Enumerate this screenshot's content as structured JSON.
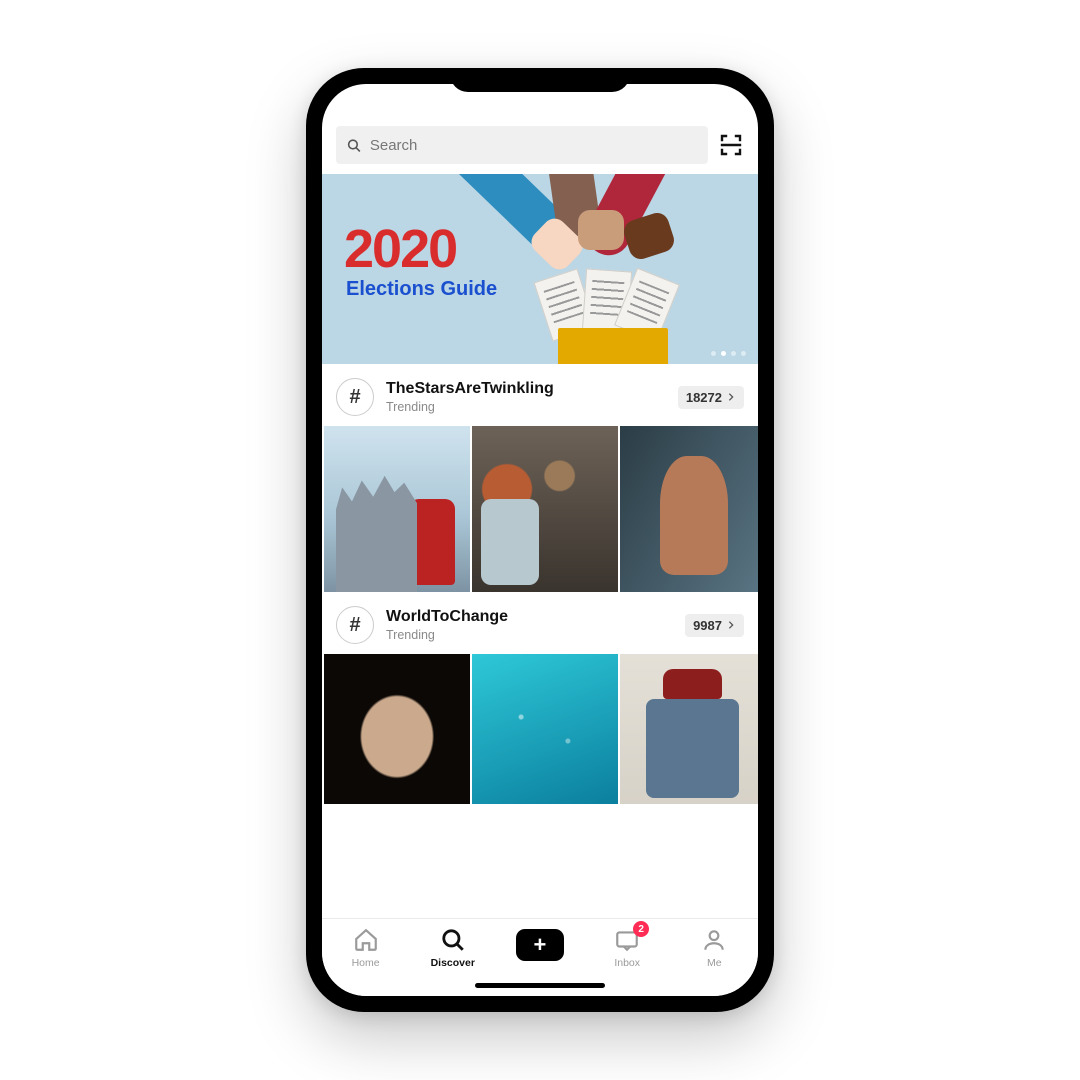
{
  "search": {
    "placeholder": "Search"
  },
  "banner": {
    "title_big": "2020",
    "title_sub": "Elections Guide"
  },
  "sections": [
    {
      "hashtag": "TheStarsAreTwinkling",
      "subtitle": "Trending",
      "count": "18272"
    },
    {
      "hashtag": "WorldToChange",
      "subtitle": "Trending",
      "count": "9987"
    }
  ],
  "tabs": {
    "home": "Home",
    "discover": "Discover",
    "inbox": "Inbox",
    "me": "Me",
    "inbox_badge": "2"
  },
  "hash_symbol": "#",
  "plus_symbol": "+"
}
